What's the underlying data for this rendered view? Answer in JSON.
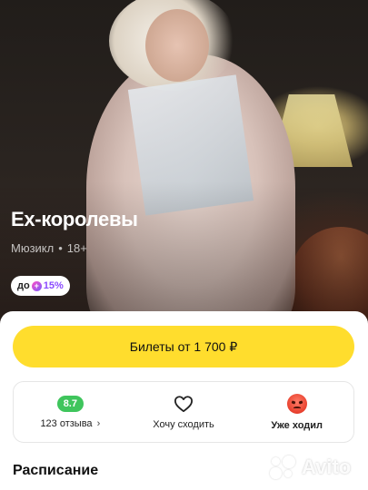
{
  "event": {
    "title": "Ex-королевы",
    "genre": "Мюзикл",
    "separator": "•",
    "age_rating": "18+",
    "promo_badge": {
      "prefix": "до",
      "value": "15%"
    }
  },
  "actions": {
    "tickets_label": "Билеты от 1 700 ₽"
  },
  "stats": {
    "rating": "8.7",
    "reviews_label": "123 отзыва",
    "want_label": "Хочу сходить",
    "went_label": "Уже ходил"
  },
  "section": {
    "schedule_title": "Расписание"
  },
  "watermark": {
    "text": "Avito"
  },
  "colors": {
    "button_yellow": "#ffdd2d",
    "rating_green": "#3fc55c",
    "promo_purple": "#8b4bff"
  }
}
